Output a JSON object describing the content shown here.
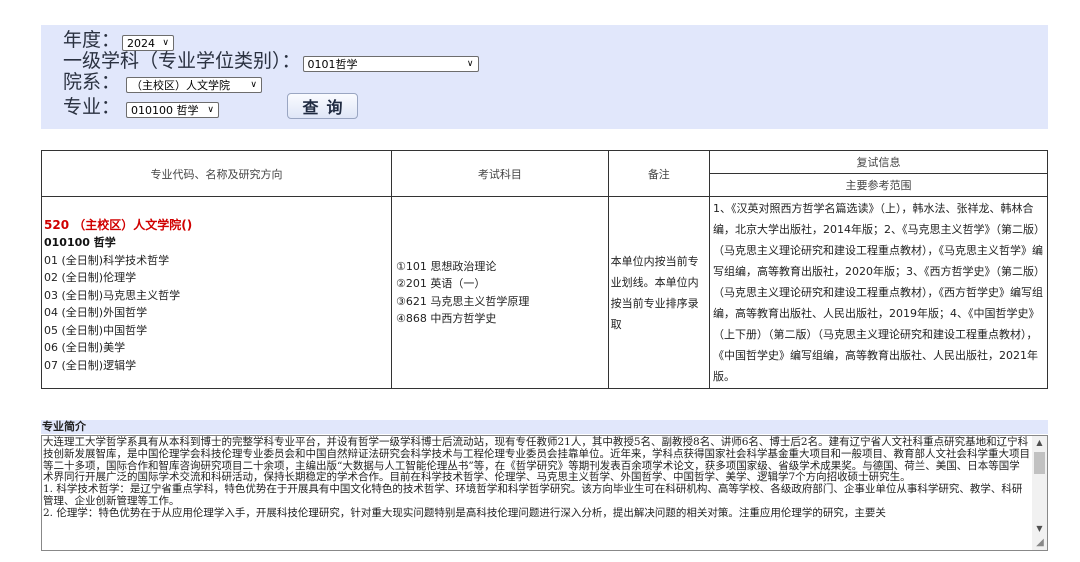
{
  "filters": {
    "year_label": "年度：",
    "year_value": "2024",
    "discipline_label": "一级学科（专业学位类别）：",
    "discipline_value": "0101哲学",
    "department_label": "院系：",
    "department_value": "（主校区）人文学院",
    "major_label": "专业：",
    "major_value": "010100 哲学",
    "query_button": "查询"
  },
  "table": {
    "headers": {
      "major": "专业代码、名称及研究方向",
      "subjects": "考试科目",
      "remarks": "备注",
      "retest": "复试信息",
      "references": "主要参考范围"
    },
    "row": {
      "college": "520 （主校区）人文学院()",
      "major": "010100 哲学",
      "directions": [
        "01 (全日制)科学技术哲学",
        "02 (全日制)伦理学",
        "03 (全日制)马克思主义哲学",
        "04 (全日制)外国哲学",
        "05 (全日制)中国哲学",
        "06 (全日制)美学",
        "07 (全日制)逻辑学"
      ],
      "subjects": [
        "①101 思想政治理论",
        "②201 英语（一）",
        "③621 马克思主义哲学原理",
        "④868 中西方哲学史"
      ],
      "remarks": "本单位内按当前专业划线。本单位内按当前专业排序录取",
      "references": "1、《汉英对照西方哲学名篇选读》（上），韩水法、张祥龙、韩林合编，北京大学出版社，2014年版；2、《马克思主义哲学》（第二版）（马克思主义理论研究和建设工程重点教材），《马克思主义哲学》编写组编，高等教育出版社，2020年版；3、《西方哲学史》（第二版）（马克思主义理论研究和建设工程重点教材），《西方哲学史》编写组编，高等教育出版社、人民出版社，2019年版；4、《中国哲学史》（上下册）（第二版）（马克思主义理论研究和建设工程重点教材），《中国哲学史》编写组编，高等教育出版社、人民出版社，2021年版。"
    }
  },
  "intro": {
    "title": "专业简介",
    "paragraphs": [
      "大连理工大学哲学系具有从本科到博士的完整学科专业平台，并设有哲学一级学科博士后流动站，现有专任教师21人，其中教授5名、副教授8名、讲师6名、博士后2名。建有辽宁省人文社科重点研究基地和辽宁科技创新发展智库，是中国伦理学会科技伦理专业委员会和中国自然辩证法研究会科学技术与工程伦理专业委员会挂靠单位。近年来，学科点获得国家社会科学基金重大项目和一般项目、教育部人文社会科学重大项目等二十多项，国际合作和智库咨询研究项目二十余项，主编出版“大数据与人工智能伦理丛书”等，在《哲学研究》等期刊发表百余项学术论文，获多项国家级、省级学术成果奖。与德国、荷兰、美国、日本等国学术界同行开展广泛的国际学术交流和科研活动，保持长期稳定的学术合作。目前在科学技术哲学、伦理学、马克思主义哲学、外国哲学、中国哲学、美学、逻辑学7个方向招收硕士研究生。",
      "1. 科学技术哲学：是辽宁省重点学科，特色优势在于开展具有中国文化特色的技术哲学、环境哲学和科学哲学研究。该方向毕业生可在科研机构、高等学校、各级政府部门、企事业单位从事科学研究、教学、科研管理、企业创新管理等工作。",
      "2. 伦理学：特色优势在于从应用伦理学入手，开展科技伦理研究，针对重大现实问题特别是高科技伦理问题进行深入分析，提出解决问题的相关对策。注重应用伦理学的研究，主要关"
    ]
  }
}
